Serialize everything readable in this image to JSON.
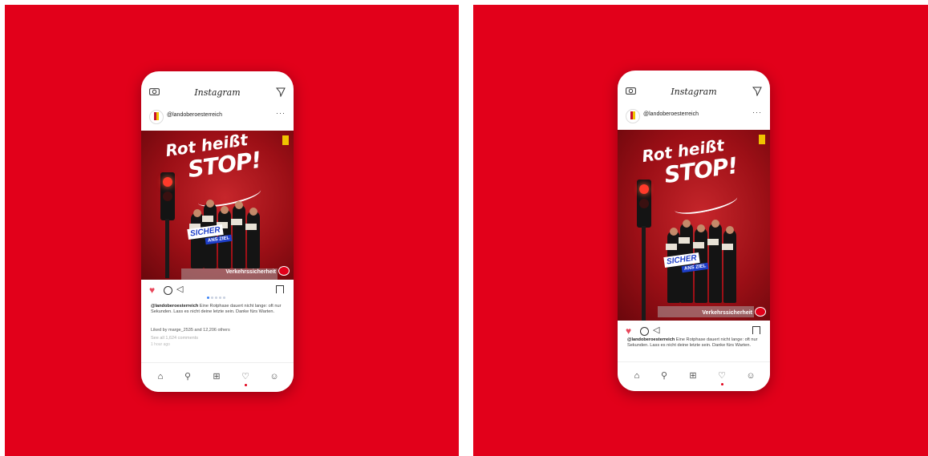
{
  "app": {
    "title": "Instagram",
    "username": "@landoberoesterreich",
    "more": "···"
  },
  "post": {
    "headline_top": "Rot heißt",
    "headline_bottom": "STOP!",
    "badge_sicher": "SICHER",
    "badge_ans_ziel": "ANS ZIEL",
    "footer_brand": "Verkehrssicherheit"
  },
  "caption": {
    "author": "@landoberoesterreich",
    "text": "Eine Rotphase dauert nicht lange: oft nur Sekunden. Lass es nicht deine letzte sein. Danke fürs Warten.",
    "likes": "Liked by marge_2535 and 12,206 others",
    "comments": "See all 1,624 comments",
    "ago": "1 hour ago"
  },
  "icons": {
    "camera": "camera-icon",
    "send": "send-icon",
    "heart": "heart-icon",
    "comment": "comment-icon",
    "share": "share-icon",
    "save": "bookmark-icon",
    "home": "home-icon",
    "search": "search-icon",
    "add": "add-post-icon",
    "activity": "activity-heart-icon",
    "profile": "profile-icon"
  },
  "colors": {
    "brand_red": "#e2001a",
    "like_heart": "#e8465a",
    "badge_blue": "#1d3ec8"
  },
  "carousel": {
    "total": 5,
    "current": 1
  }
}
